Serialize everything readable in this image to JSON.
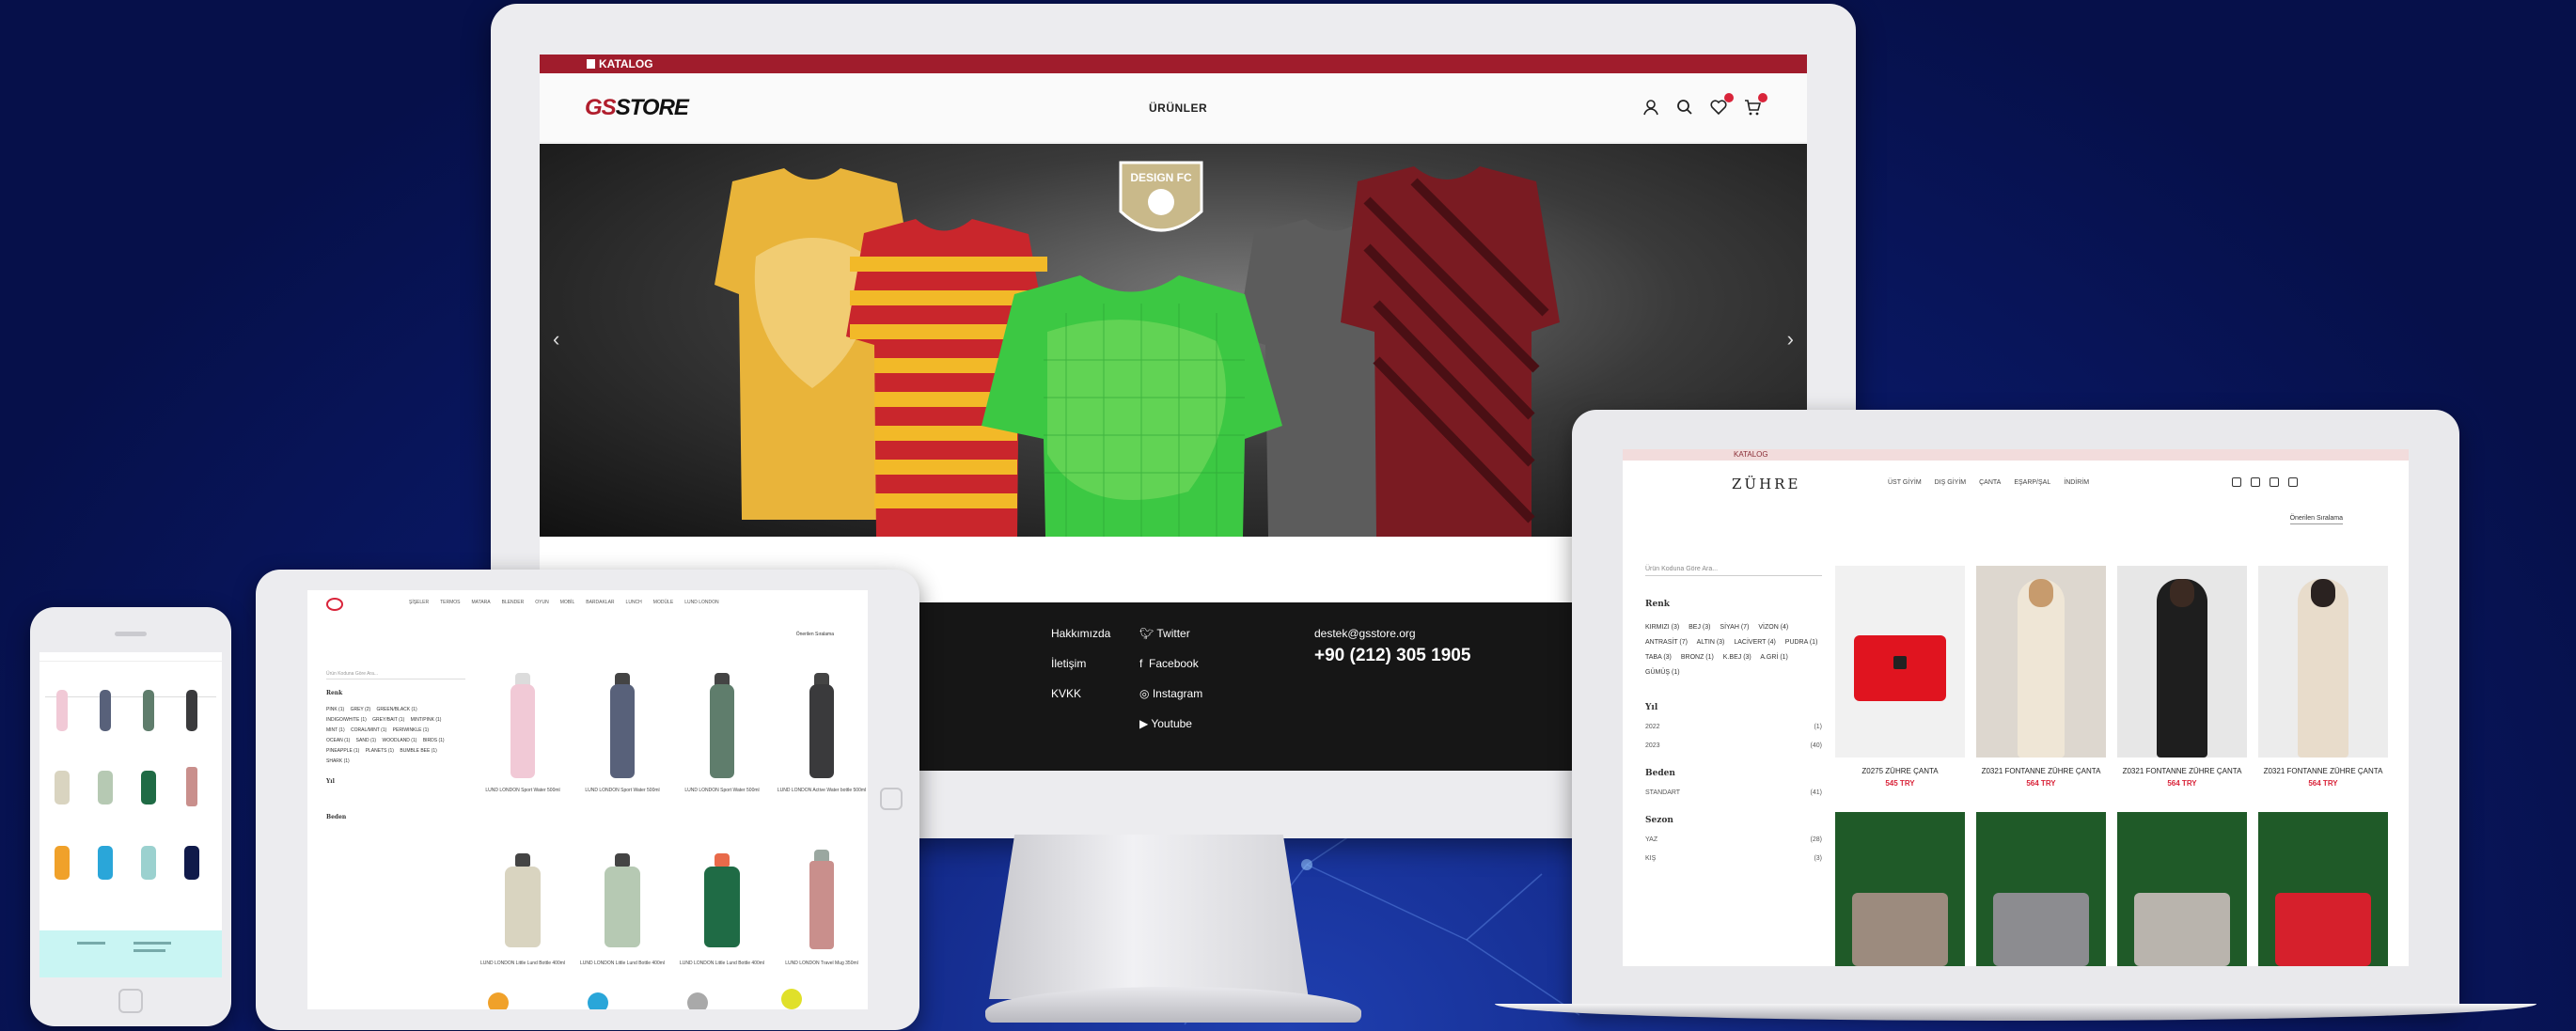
{
  "desktop": {
    "topbar_label": "KATALOG",
    "logo_prefix": "GS",
    "logo_suffix": "STORE",
    "nav_label": "ÜRÜNLER",
    "hero_crest_top": "DESIGN FC",
    "footer": {
      "links": [
        "Hakkımızda",
        "İletişim",
        "KVKK"
      ],
      "social": [
        "Twitter",
        "Facebook",
        "Instagram",
        "Youtube"
      ],
      "email": "destek@gsstore.org",
      "phone": "+90 (212) 305 1905"
    }
  },
  "laptop": {
    "topbar_label": "KATALOG",
    "logo": "ZÜHRE",
    "nav": [
      "ÜST GİYİM",
      "DIŞ GİYİM",
      "ÇANTA",
      "EŞARP/ŞAL",
      "İNDİRİM"
    ],
    "sort_label": "Önerilen Sıralama",
    "search_placeholder": "Ürün Koduna Göre Ara...",
    "filters": {
      "renk_title": "Renk",
      "renk_chips": [
        "KIRMIZI (3)",
        "BEJ (3)",
        "SİYAH (7)",
        "VİZON (4)",
        "ANTRASİT (7)",
        "ALTIN (3)",
        "LACİVERT (4)",
        "PUDRA (1)",
        "TABA (3)",
        "BRONZ (1)",
        "K.BEJ (3)",
        "A.GRİ (1)",
        "GÜMÜŞ (1)"
      ],
      "yil_title": "Yıl",
      "yil_rows": [
        {
          "label": "2022",
          "count": "(1)"
        },
        {
          "label": "2023",
          "count": "(40)"
        }
      ],
      "beden_title": "Beden",
      "beden_rows": [
        {
          "label": "STANDART",
          "count": "(41)"
        }
      ],
      "sezon_title": "Sezon",
      "sezon_rows": [
        {
          "label": "YAZ",
          "count": "(28)"
        },
        {
          "label": "KIŞ",
          "count": "(3)"
        }
      ]
    },
    "products": [
      {
        "name": "Z0275 ZÜHRE ÇANTA",
        "price": "545 TRY"
      },
      {
        "name": "Z0321 FONTANNE ZÜHRE ÇANTA",
        "price": "564 TRY"
      },
      {
        "name": "Z0321 FONTANNE ZÜHRE ÇANTA",
        "price": "564 TRY"
      },
      {
        "name": "Z0321 FONTANNE ZÜHRE ÇANTA",
        "price": "564 TRY"
      }
    ]
  },
  "tablet": {
    "nav": [
      "ŞİŞELER",
      "TERMOS",
      "MATARA",
      "BLENDER",
      "OYUN",
      "MOBİL",
      "BARDAKLAR",
      "LUNCH",
      "MODÜLE",
      "LUND LONDON"
    ],
    "sort_label": "Önerilen Sıralama",
    "search_placeholder": "Ürün Koduna Göre Ara...",
    "renk_title": "Renk",
    "renk_chips": [
      "PINK (1)",
      "GREY (2)",
      "GREEN/BLACK (1)",
      "INDIGO/WHITE (1)",
      "GREY/BAIT (1)",
      "MINT/PINK (1)",
      "MINT (1)",
      "CORAL/MINT (1)",
      "PERIWINKLE (1)",
      "OCEAN (1)",
      "SAND (1)",
      "WOODLAND (1)",
      "BIRDS (1)",
      "PINEAPPLE (1)",
      "PLANETS (1)",
      "BUMBLE BEE (1)",
      "SHARK (1)"
    ],
    "yil_title": "Yıl",
    "beden_title": "Beden",
    "products": [
      {
        "name": "LUND LONDON Sport Water 500ml"
      },
      {
        "name": "LUND LONDON Sport Water 500ml"
      },
      {
        "name": "LUND LONDON Sport Water 500ml"
      },
      {
        "name": "LUND LONDON Active Water bottle 500ml"
      },
      {
        "name": "LUND LONDON Little Lund Bottle 400ml"
      },
      {
        "name": "LUND LONDON Little Lund Bottle 400ml"
      },
      {
        "name": "LUND LONDON Little Lund Bottle 400ml"
      },
      {
        "name": "LUND LONDON Travel Mug 350ml"
      }
    ]
  },
  "colors": {
    "brand_red": "#a01c2c",
    "price_red": "#d9243a",
    "footer_dark": "#161616",
    "phone_footer": "#c9f5f3"
  }
}
